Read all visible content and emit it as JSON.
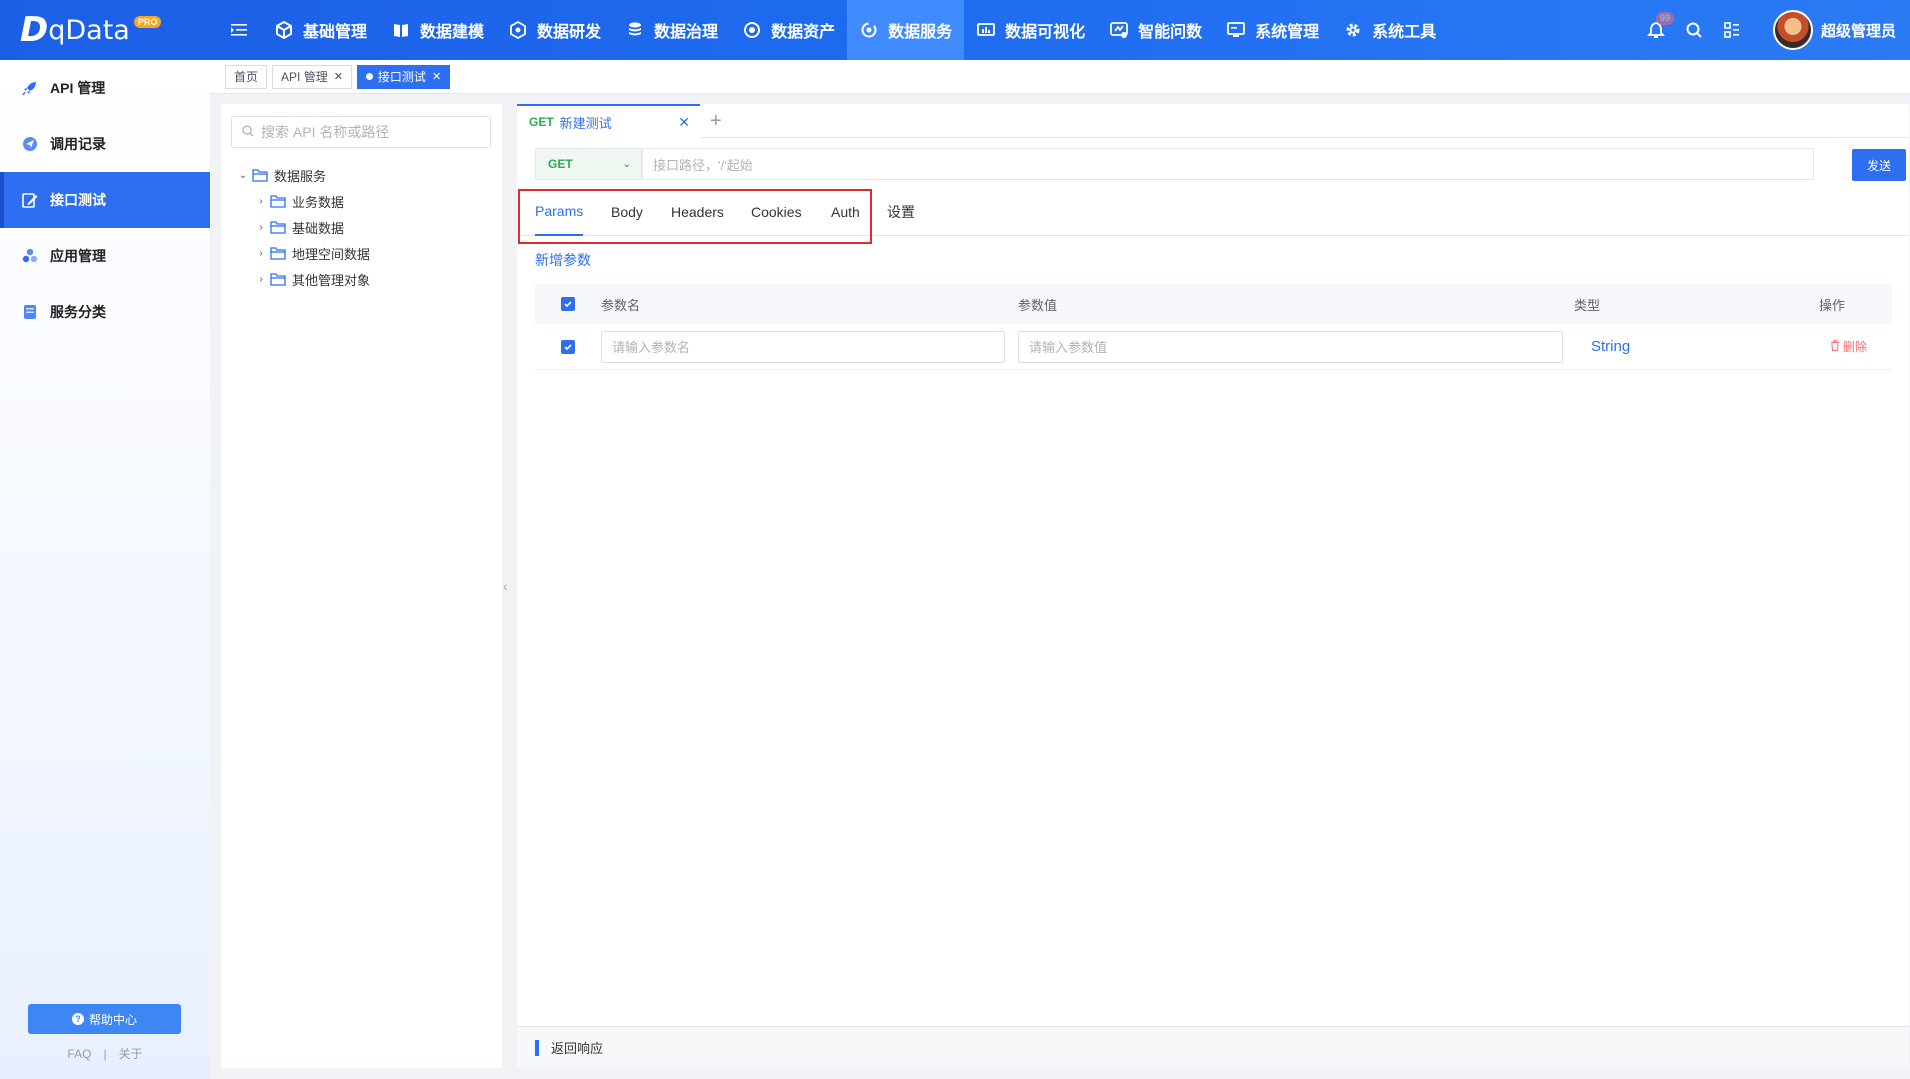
{
  "brand": {
    "logo_text": "qData",
    "badge": "PRO"
  },
  "nav": {
    "items": [
      {
        "label": "基础管理",
        "icon": "cube-icon"
      },
      {
        "label": "数据建模",
        "icon": "book-icon"
      },
      {
        "label": "数据研发",
        "icon": "box-icon"
      },
      {
        "label": "数据治理",
        "icon": "database-icon"
      },
      {
        "label": "数据资产",
        "icon": "target-icon"
      },
      {
        "label": "数据服务",
        "icon": "service-icon"
      },
      {
        "label": "数据可视化",
        "icon": "chart-icon"
      },
      {
        "label": "智能问数",
        "icon": "ai-icon"
      },
      {
        "label": "系统管理",
        "icon": "monitor-icon"
      },
      {
        "label": "系统工具",
        "icon": "gear-icon"
      }
    ],
    "active_index": 5,
    "notification_count": "99",
    "user_name": "超级管理员"
  },
  "sidebar": {
    "items": [
      {
        "label": "API 管理",
        "icon": "rocket-icon"
      },
      {
        "label": "调用记录",
        "icon": "send-icon"
      },
      {
        "label": "接口测试",
        "icon": "edit-icon"
      },
      {
        "label": "应用管理",
        "icon": "apps-icon"
      },
      {
        "label": "服务分类",
        "icon": "category-icon"
      }
    ],
    "active_index": 2,
    "help_label": "帮助中心",
    "faq_label": "FAQ",
    "separator": "|",
    "about_label": "关于"
  },
  "tags": {
    "home": "首页",
    "api": "API 管理",
    "current": "接口测试"
  },
  "tree": {
    "search_placeholder": "搜索 API 名称或路径",
    "root": "数据服务",
    "children": [
      "业务数据",
      "基础数据",
      "地理空间数据",
      "其他管理对象"
    ]
  },
  "request": {
    "tab_method": "GET",
    "tab_name": "新建测试",
    "method": "GET",
    "url_placeholder": "接口路径，'/'起始",
    "send_label": "发送",
    "param_tabs": [
      "Params",
      "Body",
      "Headers",
      "Cookies",
      "Auth",
      "设置"
    ],
    "active_param_tab": 0,
    "add_param_label": "新增参数",
    "table": {
      "headers": {
        "name": "参数名",
        "value": "参数值",
        "type": "类型",
        "action": "操作"
      },
      "rows": [
        {
          "name_placeholder": "请输入参数名",
          "value_placeholder": "请输入参数值",
          "type": "String",
          "delete_label": "删除",
          "checked": true
        }
      ]
    },
    "response_label": "返回响应"
  },
  "colors": {
    "primary": "#2e6ff2",
    "success": "#2daa4f",
    "danger": "#f56c6c",
    "highlight": "#e02c2c"
  }
}
